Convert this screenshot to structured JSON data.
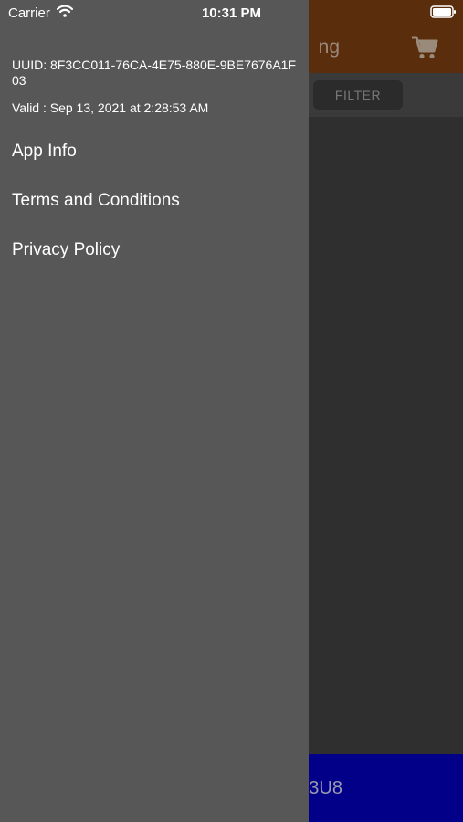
{
  "status_bar": {
    "carrier": "Carrier",
    "time": "10:31 PM",
    "wifi_icon": "wifi-icon",
    "battery_icon": "battery-icon"
  },
  "app": {
    "header_title_partial": "ng",
    "cart_icon": "cart-icon",
    "filter_label": "FILTER",
    "bottom_code_partial": "3U8",
    "colors": {
      "header_bg": "#5a2e0d",
      "bottom_bar_bg": "#020088",
      "content_bg": "#2f2f2f"
    }
  },
  "drawer": {
    "uuid": "UUID: 8F3CC011-76CA-4E75-880E-9BE7676A1F03",
    "valid": "Valid : Sep 13, 2021 at 2:28:53 AM",
    "menu": [
      {
        "label": "App Info"
      },
      {
        "label": "Terms and Conditions"
      },
      {
        "label": "Privacy Policy"
      }
    ],
    "background": "#575757"
  }
}
